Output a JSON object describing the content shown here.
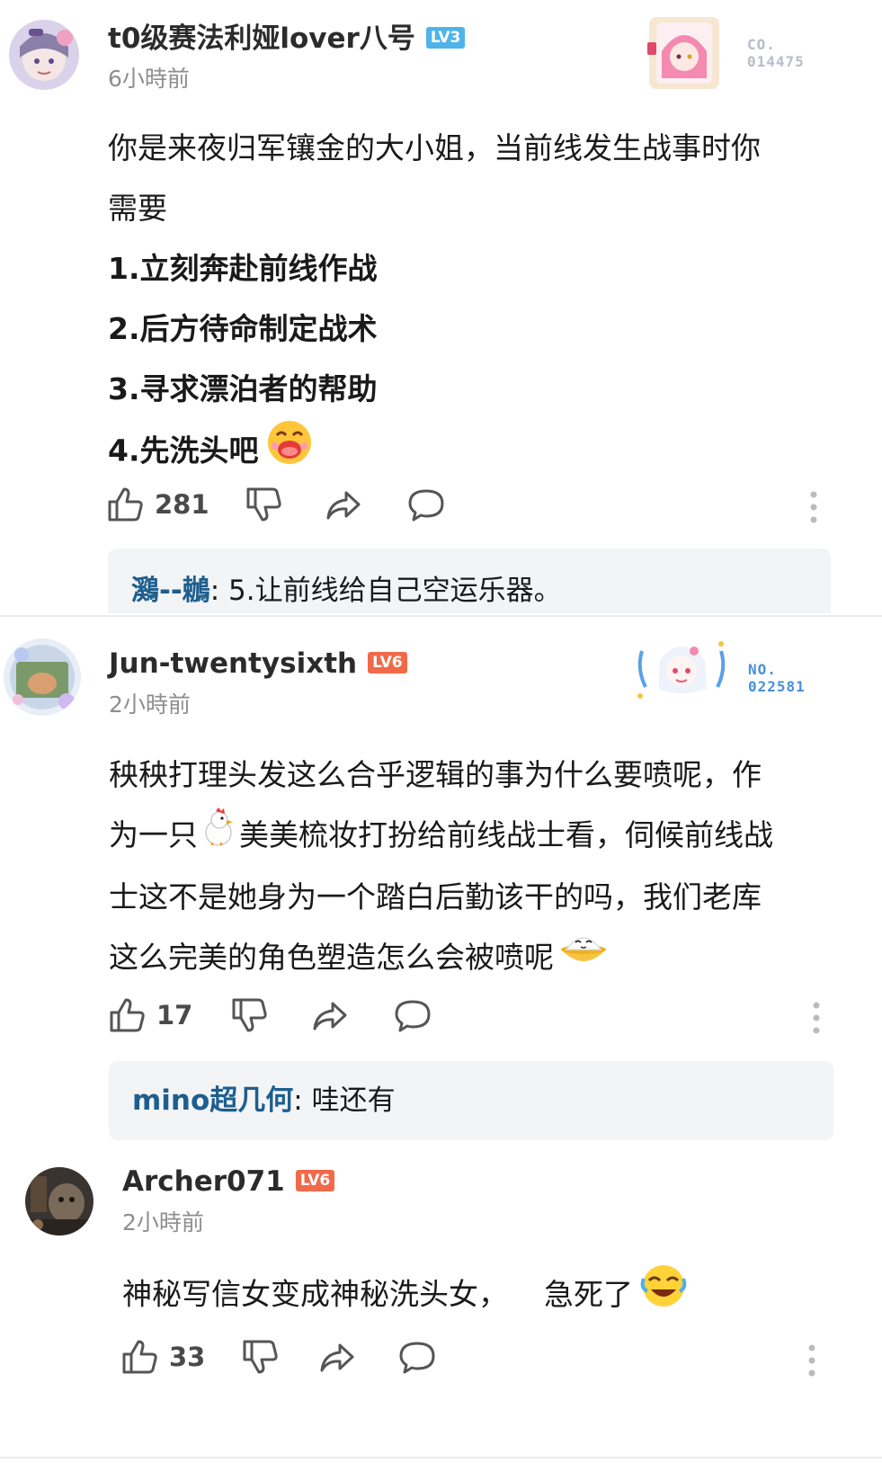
{
  "comments": [
    {
      "username": "t0级赛法利娅lover八号",
      "level": "LV3",
      "level_color": "#4fb3e8",
      "time": "6小時前",
      "badge_no": "CO.\n014475",
      "body": [
        "你是来夜归军镶金的大小姐，当前线发生战事时你",
        "需要",
        "1.立刻奔赴前线作战",
        "2.后方待命制定战术",
        "3.寻求漂泊者的帮助",
        "4.先洗头吧"
      ],
      "likes": "281",
      "reply": {
        "user": "鸂--鶒",
        "text": ": 5.让前线给自己空运乐器。"
      }
    },
    {
      "username": "Jun-twentysixth",
      "level": "LV6",
      "level_color": "#f06a4a",
      "time": "2小時前",
      "badge_no": "NO.\n022581",
      "body": [
        "秧秧打理头发这么合乎逻辑的事为什么要喷呢，作",
        "为一只",
        "美美梳妆打扮给前线战士看，伺候前线战",
        "士这不是她身为一个踏白后勤该干的吗，我们老库",
        "这么完美的角色塑造怎么会被喷呢"
      ],
      "likes": "17",
      "reply": {
        "user": "mino超几何",
        "text": ": 哇还有"
      }
    },
    {
      "username": "Archer071",
      "level": "LV6",
      "level_color": "#f06a4a",
      "time": "2小時前",
      "body": [
        "神秘写信女变成神秘洗头女，",
        "急死了"
      ],
      "likes": "33"
    }
  ],
  "icons": {
    "like": "thumbs-up-icon",
    "dislike": "thumbs-down-icon",
    "share": "share-arrow-icon",
    "reply": "comment-bubble-icon",
    "more": "more-vertical-icon"
  }
}
